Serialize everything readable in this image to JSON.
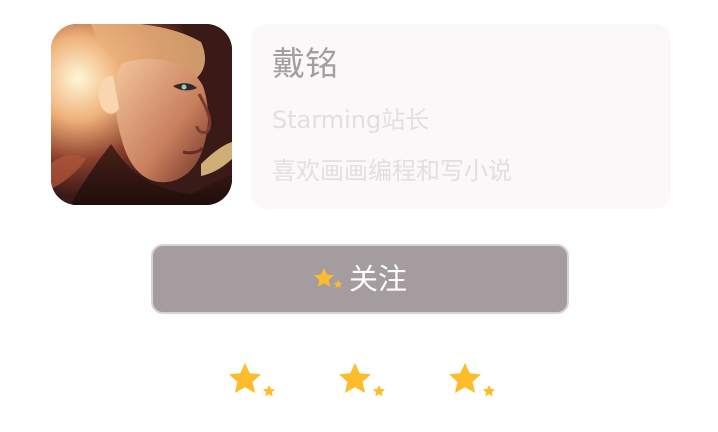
{
  "profile": {
    "avatar_alt": "avatar",
    "name": "戴铭",
    "title": "Starming站长",
    "bio": "喜欢画画编程和写小说"
  },
  "follow_button": {
    "label": "关注",
    "icon": "star-icon"
  },
  "rating": {
    "icon": "star-icon",
    "count": 3
  },
  "colors": {
    "star": "#fcbc2c",
    "button_bg": "#a59ca0",
    "name_text": "#a49ea1",
    "muted_text": "#e3dee1",
    "card_bg": "#faf8f9"
  }
}
